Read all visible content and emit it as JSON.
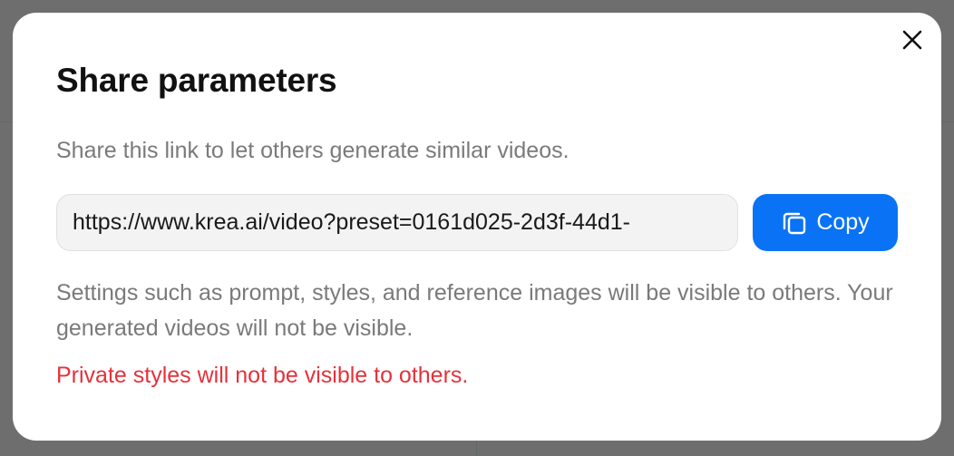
{
  "dialog": {
    "title": "Share parameters",
    "description": "Share this link to let others generate similar videos.",
    "share_link": "https://www.krea.ai/video?preset=0161d025-2d3f-44d1-",
    "copy_label": "Copy",
    "info_text": "Settings such as prompt, styles, and reference images will be visible to others. Your generated videos will not be visible.",
    "warning_text": "Private styles will not be visible to others."
  },
  "icons": {
    "close": "close-icon",
    "copy": "copy-icon"
  },
  "colors": {
    "accent": "#0a73f5",
    "warning": "#e5323b",
    "overlay": "#6e6e6e",
    "muted_text": "#7a7a7a"
  }
}
